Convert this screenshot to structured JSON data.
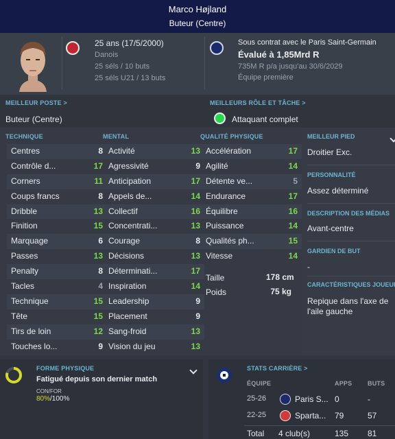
{
  "header": {
    "name": "Marco Højland",
    "position": "Buteur (Centre)"
  },
  "info_left": {
    "age_line": "25 ans (17/5/2000)",
    "nationality": "Danois",
    "caps": "25 séls / 10 buts",
    "caps_u21": "25 séls U21 / 13 buts"
  },
  "info_right": {
    "contract": "Sous contrat avec le Paris Saint-Germain",
    "value": "Évalué à 1,85Mrd R",
    "wage": "735M R p/a jusqu'au 30/6/2029",
    "squad": "Équipe première"
  },
  "best_position": {
    "title": "MEILLEUR POSTE >",
    "value": "Buteur (Centre)"
  },
  "best_role": {
    "title": "MEILLEURS RÔLE ET TÂCHE >",
    "value": "Attaquant complet"
  },
  "sections": {
    "technical": "TECHNIQUE",
    "mental": "MENTAL",
    "physical": "QUALITÉ PHYSIQUE"
  },
  "technical": [
    {
      "name": "Centres",
      "value": "8",
      "tier": "w"
    },
    {
      "name": "Contrôle d...",
      "value": "17",
      "tier": "g"
    },
    {
      "name": "Corners",
      "value": "11",
      "tier": "g"
    },
    {
      "name": "Coups francs",
      "value": "8",
      "tier": "w"
    },
    {
      "name": "Dribble",
      "value": "13",
      "tier": "g"
    },
    {
      "name": "Finition",
      "value": "15",
      "tier": "g"
    },
    {
      "name": "Marquage",
      "value": "6",
      "tier": "w"
    },
    {
      "name": "Passes",
      "value": "13",
      "tier": "g"
    },
    {
      "name": "Penalty",
      "value": "8",
      "tier": "w"
    },
    {
      "name": "Tacles",
      "value": "4",
      "tier": "d"
    },
    {
      "name": "Technique",
      "value": "15",
      "tier": "g"
    },
    {
      "name": "Tête",
      "value": "15",
      "tier": "g"
    },
    {
      "name": "Tirs de loin",
      "value": "12",
      "tier": "g"
    },
    {
      "name": "Touches lo...",
      "value": "9",
      "tier": "w"
    }
  ],
  "mental": [
    {
      "name": "Activité",
      "value": "13",
      "tier": "g"
    },
    {
      "name": "Agressivité",
      "value": "9",
      "tier": "w"
    },
    {
      "name": "Anticipation",
      "value": "17",
      "tier": "g"
    },
    {
      "name": "Appels de...",
      "value": "14",
      "tier": "g"
    },
    {
      "name": "Collectif",
      "value": "16",
      "tier": "g"
    },
    {
      "name": "Concentrati...",
      "value": "13",
      "tier": "g"
    },
    {
      "name": "Courage",
      "value": "8",
      "tier": "w"
    },
    {
      "name": "Décisions",
      "value": "13",
      "tier": "g"
    },
    {
      "name": "Déterminati...",
      "value": "17",
      "tier": "g"
    },
    {
      "name": "Inspiration",
      "value": "14",
      "tier": "g"
    },
    {
      "name": "Leadership",
      "value": "9",
      "tier": "w"
    },
    {
      "name": "Placement",
      "value": "9",
      "tier": "w"
    },
    {
      "name": "Sang-froid",
      "value": "13",
      "tier": "g"
    },
    {
      "name": "Vision du jeu",
      "value": "13",
      "tier": "g"
    }
  ],
  "physical": [
    {
      "name": "Accélération",
      "value": "17",
      "tier": "g"
    },
    {
      "name": "Agilité",
      "value": "14",
      "tier": "g"
    },
    {
      "name": "Détente ve...",
      "value": "5",
      "tier": "d"
    },
    {
      "name": "Endurance",
      "value": "17",
      "tier": "g"
    },
    {
      "name": "Équilibre",
      "value": "16",
      "tier": "g"
    },
    {
      "name": "Puissance",
      "value": "14",
      "tier": "g"
    },
    {
      "name": "Qualités ph...",
      "value": "15",
      "tier": "g"
    },
    {
      "name": "Vitesse",
      "value": "14",
      "tier": "g"
    }
  ],
  "body": {
    "height_label": "Taille",
    "height": "178 cm",
    "weight_label": "Poids",
    "weight": "75 kg"
  },
  "right_panel": {
    "foot_title": "MEILLEUR PIED",
    "foot": "Droitier Exc.",
    "personality_title": "PERSONNALITÉ",
    "personality": "Assez déterminé",
    "media_title": "DESCRIPTION DES MÉDIAS",
    "media": "Avant-centre",
    "gk_title": "GARDIEN DE BUT",
    "gk": "-",
    "traits_title": "CARACTÉRISTIQUES JOUEUR",
    "traits": "Repique dans l'axe de l'aile gauche"
  },
  "fitness": {
    "title": "FORME PHYSIQUE",
    "status": "Fatigué depuis son dernier match",
    "cond_label": "CON/FOR",
    "cond_value": "80%",
    "cond_max": "/100%",
    "condition_fraction": 0.8
  },
  "career": {
    "title": "STATS CARRIÈRE >",
    "headers": {
      "team": "ÉQUIPE",
      "apps": "APPS",
      "goals": "BUTS"
    },
    "rows": [
      {
        "season": "25-26",
        "club": "Paris S...",
        "apps": "0",
        "goals": "-"
      },
      {
        "season": "22-25",
        "club": "Sparta...",
        "apps": "79",
        "goals": "57"
      }
    ],
    "total": {
      "label": "Total",
      "clubs": "4 club(s)",
      "apps": "135",
      "goals": "81"
    }
  },
  "colors": {
    "header": "#141a48",
    "accent": "#6fb4d0",
    "good": "#7ed84c",
    "ok_dot": "#29d84a"
  }
}
